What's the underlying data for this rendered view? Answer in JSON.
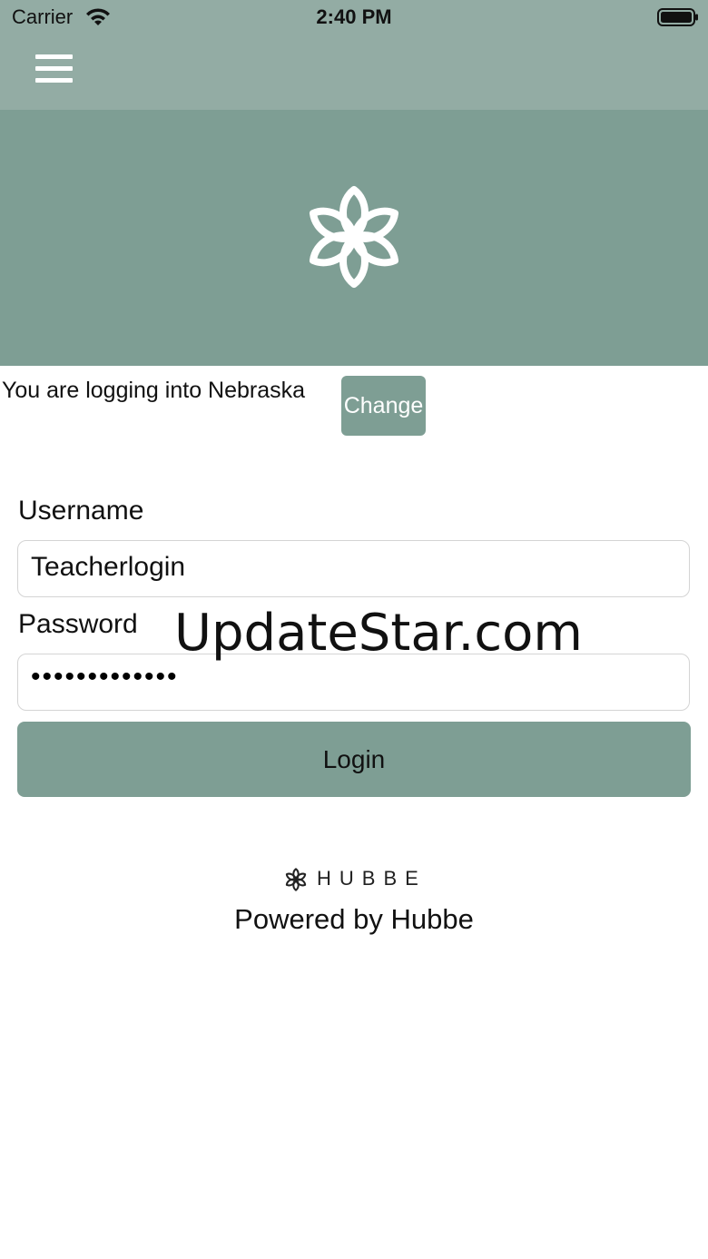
{
  "status_bar": {
    "carrier": "Carrier",
    "time": "2:40 PM",
    "icons": [
      "wifi-icon",
      "battery-icon"
    ]
  },
  "nav": {
    "menu_icon": "hamburger-menu-icon"
  },
  "hero": {
    "logo_icon": "hubbe-flower-logo-icon"
  },
  "state_selector": {
    "text": "You are logging into Nebraska",
    "change_label": "Change"
  },
  "form": {
    "username_label": "Username",
    "username_value": "Teacherlogin",
    "password_label": "Password",
    "password_masked": "•••••••••••••",
    "login_label": "Login"
  },
  "watermark": "UpdateStar.com",
  "footer": {
    "wordmark": "HUBBE",
    "powered_by": "Powered by Hubbe"
  },
  "colors": {
    "nav_bg": "#93aca4",
    "hero_bg": "#7e9e94",
    "button_bg": "#7e9e94",
    "field_border": "#d4d4d4"
  }
}
